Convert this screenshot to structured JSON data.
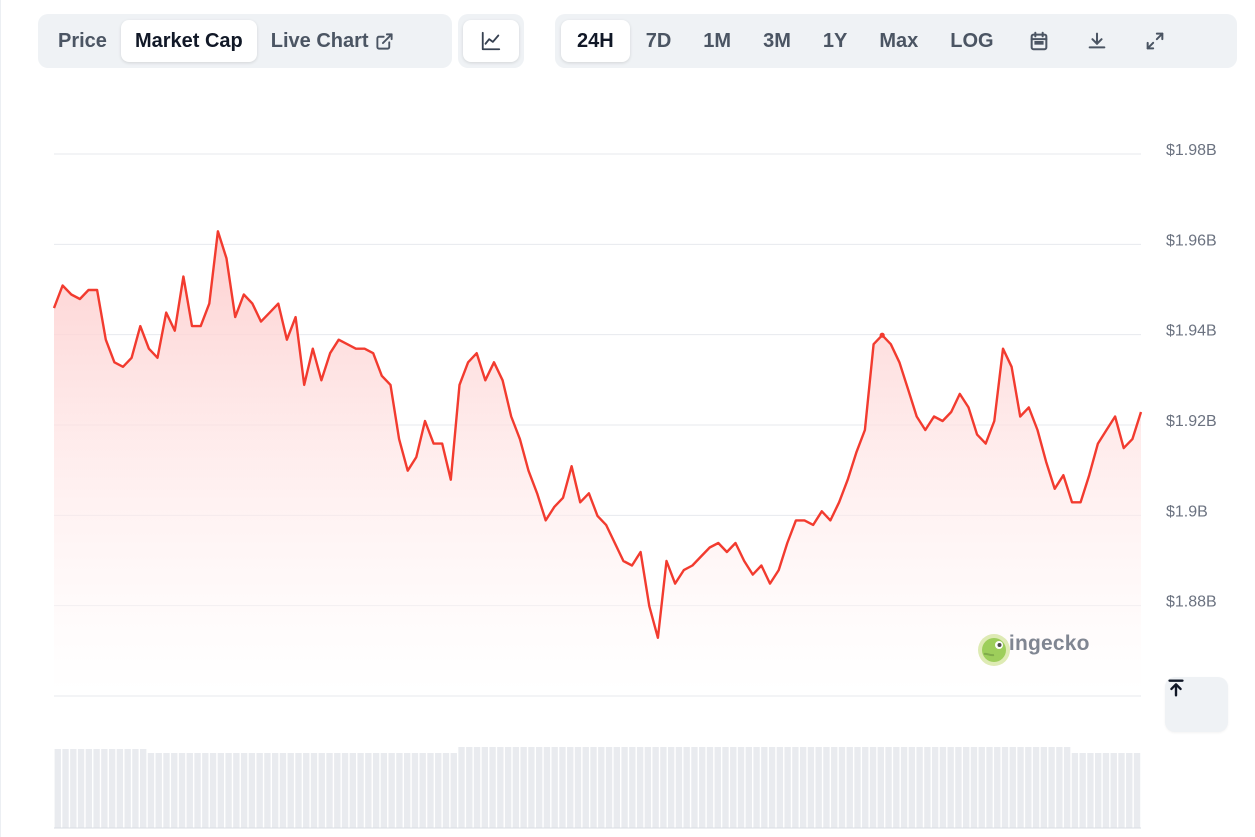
{
  "toolbar": {
    "view_tabs": [
      {
        "label": "Price",
        "active": false
      },
      {
        "label": "Market Cap",
        "active": true
      },
      {
        "label": "Live Chart",
        "active": false,
        "icon": "external-link-icon"
      }
    ],
    "chart_type_icon": "line-chart-icon",
    "ranges": [
      {
        "label": "24H",
        "active": true
      },
      {
        "label": "7D",
        "active": false
      },
      {
        "label": "1M",
        "active": false
      },
      {
        "label": "3M",
        "active": false
      },
      {
        "label": "1Y",
        "active": false
      },
      {
        "label": "Max",
        "active": false
      },
      {
        "label": "LOG",
        "active": false
      }
    ],
    "action_icons": [
      "calendar-icon",
      "download-icon",
      "fullscreen-icon"
    ]
  },
  "watermark": {
    "text": "coingecko",
    "icon": "coingecko-logo-icon"
  },
  "scroll_top_icon": "arrow-up-to-line-icon",
  "colors": {
    "line": "#f23b2f",
    "fill_top": "#fecaca",
    "grid": "#e7e9ee",
    "axis_text": "#6b7280",
    "volume": "#e9ebef"
  },
  "chart_data": {
    "type": "area",
    "y_unit": "USD billions",
    "ylim": [
      1.86,
      1.98
    ],
    "y_ticks": [
      1.98,
      1.96,
      1.94,
      1.92,
      1.9,
      1.88
    ],
    "y_tick_labels": [
      "$1.98B",
      "$1.96B",
      "$1.94B",
      "$1.92B",
      "$1.9B",
      "$1.88B"
    ],
    "grid": true,
    "series": [
      {
        "values": [
          1.945,
          1.95,
          1.948,
          1.947,
          1.949,
          1.949,
          1.938,
          1.933,
          1.932,
          1.934,
          1.941,
          1.936,
          1.934,
          1.944,
          1.94,
          1.952,
          1.941,
          1.941,
          1.946,
          1.962,
          1.956,
          1.943,
          1.948,
          1.946,
          1.942,
          1.944,
          1.946,
          1.938,
          1.943,
          1.928,
          1.936,
          1.929,
          1.935,
          1.938,
          1.937,
          1.936,
          1.936,
          1.935,
          1.93,
          1.928,
          1.916,
          1.909,
          1.912,
          1.92,
          1.915,
          1.915,
          1.907,
          1.928,
          1.933,
          1.935,
          1.929,
          1.933,
          1.929,
          1.921,
          1.916,
          1.909,
          1.904,
          1.898,
          1.901,
          1.903,
          1.91,
          1.902,
          1.904,
          1.899,
          1.897,
          1.893,
          1.889,
          1.888,
          1.891,
          1.879,
          1.872,
          1.889,
          1.884,
          1.887,
          1.888,
          1.89,
          1.892,
          1.893,
          1.891,
          1.893,
          1.889,
          1.886,
          1.888,
          1.884,
          1.887,
          1.893,
          1.898,
          1.898,
          1.897,
          1.9,
          1.898,
          1.902,
          1.907,
          1.913,
          1.918,
          1.937,
          1.939,
          1.937,
          1.933,
          1.927,
          1.921,
          1.918,
          1.921,
          1.92,
          1.922,
          1.926,
          1.923,
          1.917,
          1.915,
          1.92,
          1.936,
          1.932,
          1.921,
          1.923,
          1.918,
          1.911,
          1.905,
          1.908,
          1.902,
          1.902,
          1.908,
          1.915,
          1.918,
          1.921,
          1.914,
          1.916,
          1.922
        ]
      }
    ],
    "peak_marker_index": 96,
    "volume_bars": true
  }
}
